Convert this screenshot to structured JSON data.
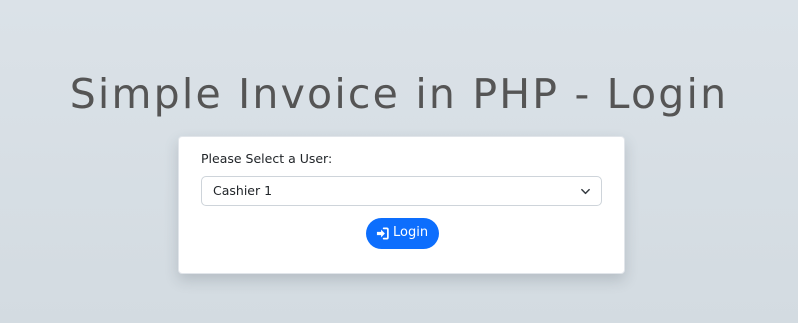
{
  "page": {
    "title": "Simple Invoice in PHP - Login"
  },
  "login_form": {
    "user_label": "Please Select a User:",
    "user_select": {
      "selected_value": "Cashier 1",
      "icon": "chevron-down-icon"
    },
    "login_button": {
      "label": "Login",
      "icon": "sign-in-icon"
    }
  },
  "colors": {
    "background": "#d9e0e6",
    "title_text": "#555555",
    "card_background": "#ffffff",
    "button_primary": "#0d6efd",
    "button_text": "#ffffff"
  }
}
